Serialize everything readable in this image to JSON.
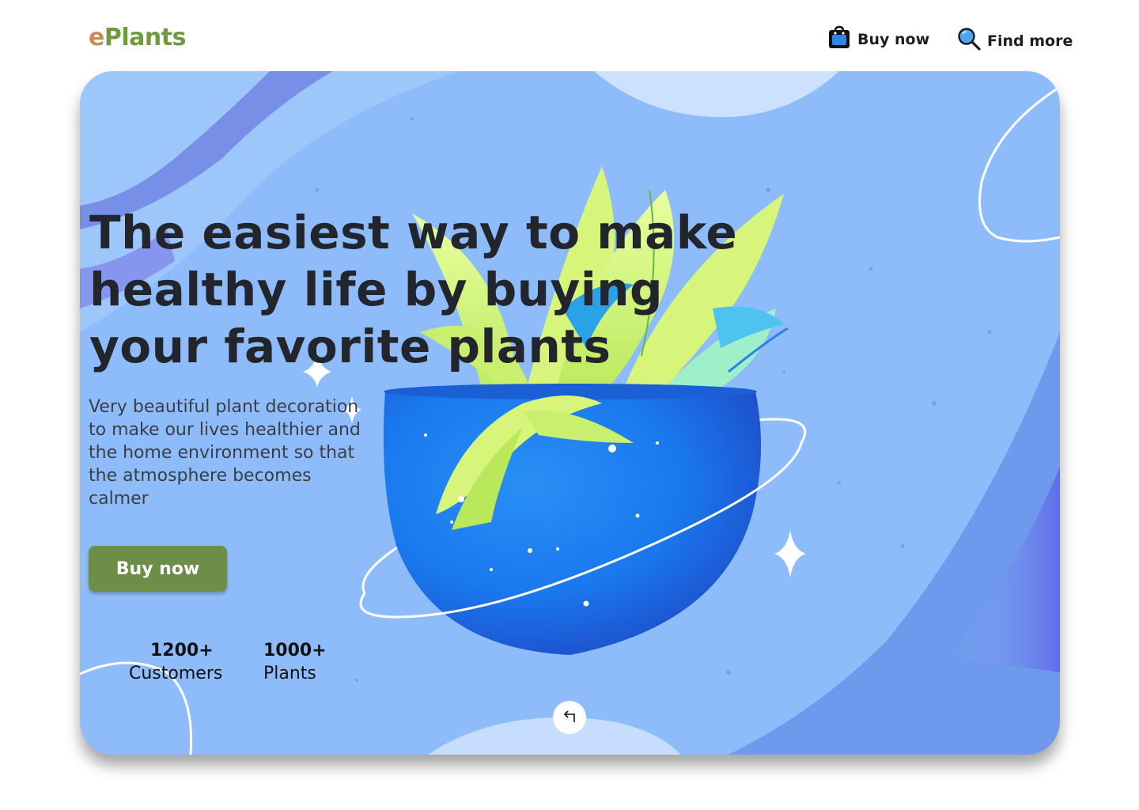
{
  "brand": {
    "logo_prefix": "e",
    "logo_rest": "Plants"
  },
  "nav": {
    "buy_label": "Buy now",
    "buy_icon": "shopping-bag-icon",
    "find_label": "Find more",
    "find_icon": "search-icon"
  },
  "hero": {
    "headline_lines": [
      "The easiest way to make",
      "healthy life by buying",
      "your favorite plants"
    ],
    "description_lines": [
      "Very beautiful plant decoration",
      "to make our lives healthier and",
      "the home environment so that",
      "the atmosphere becomes",
      "calmer"
    ],
    "cta_label": "Buy now",
    "stats": [
      {
        "value": "1200+",
        "label": "Customers"
      },
      {
        "value": "1000+",
        "label": "Plants"
      }
    ],
    "back_icon": "return-arrow-icon"
  },
  "colors": {
    "hero_background": "#8ebcfb",
    "cta": "#6c8e48",
    "logo_e": "#c98a5a",
    "logo_rest": "#6f9a3f",
    "pot": "#1f7ff0",
    "leaves": "#d7f57a"
  }
}
